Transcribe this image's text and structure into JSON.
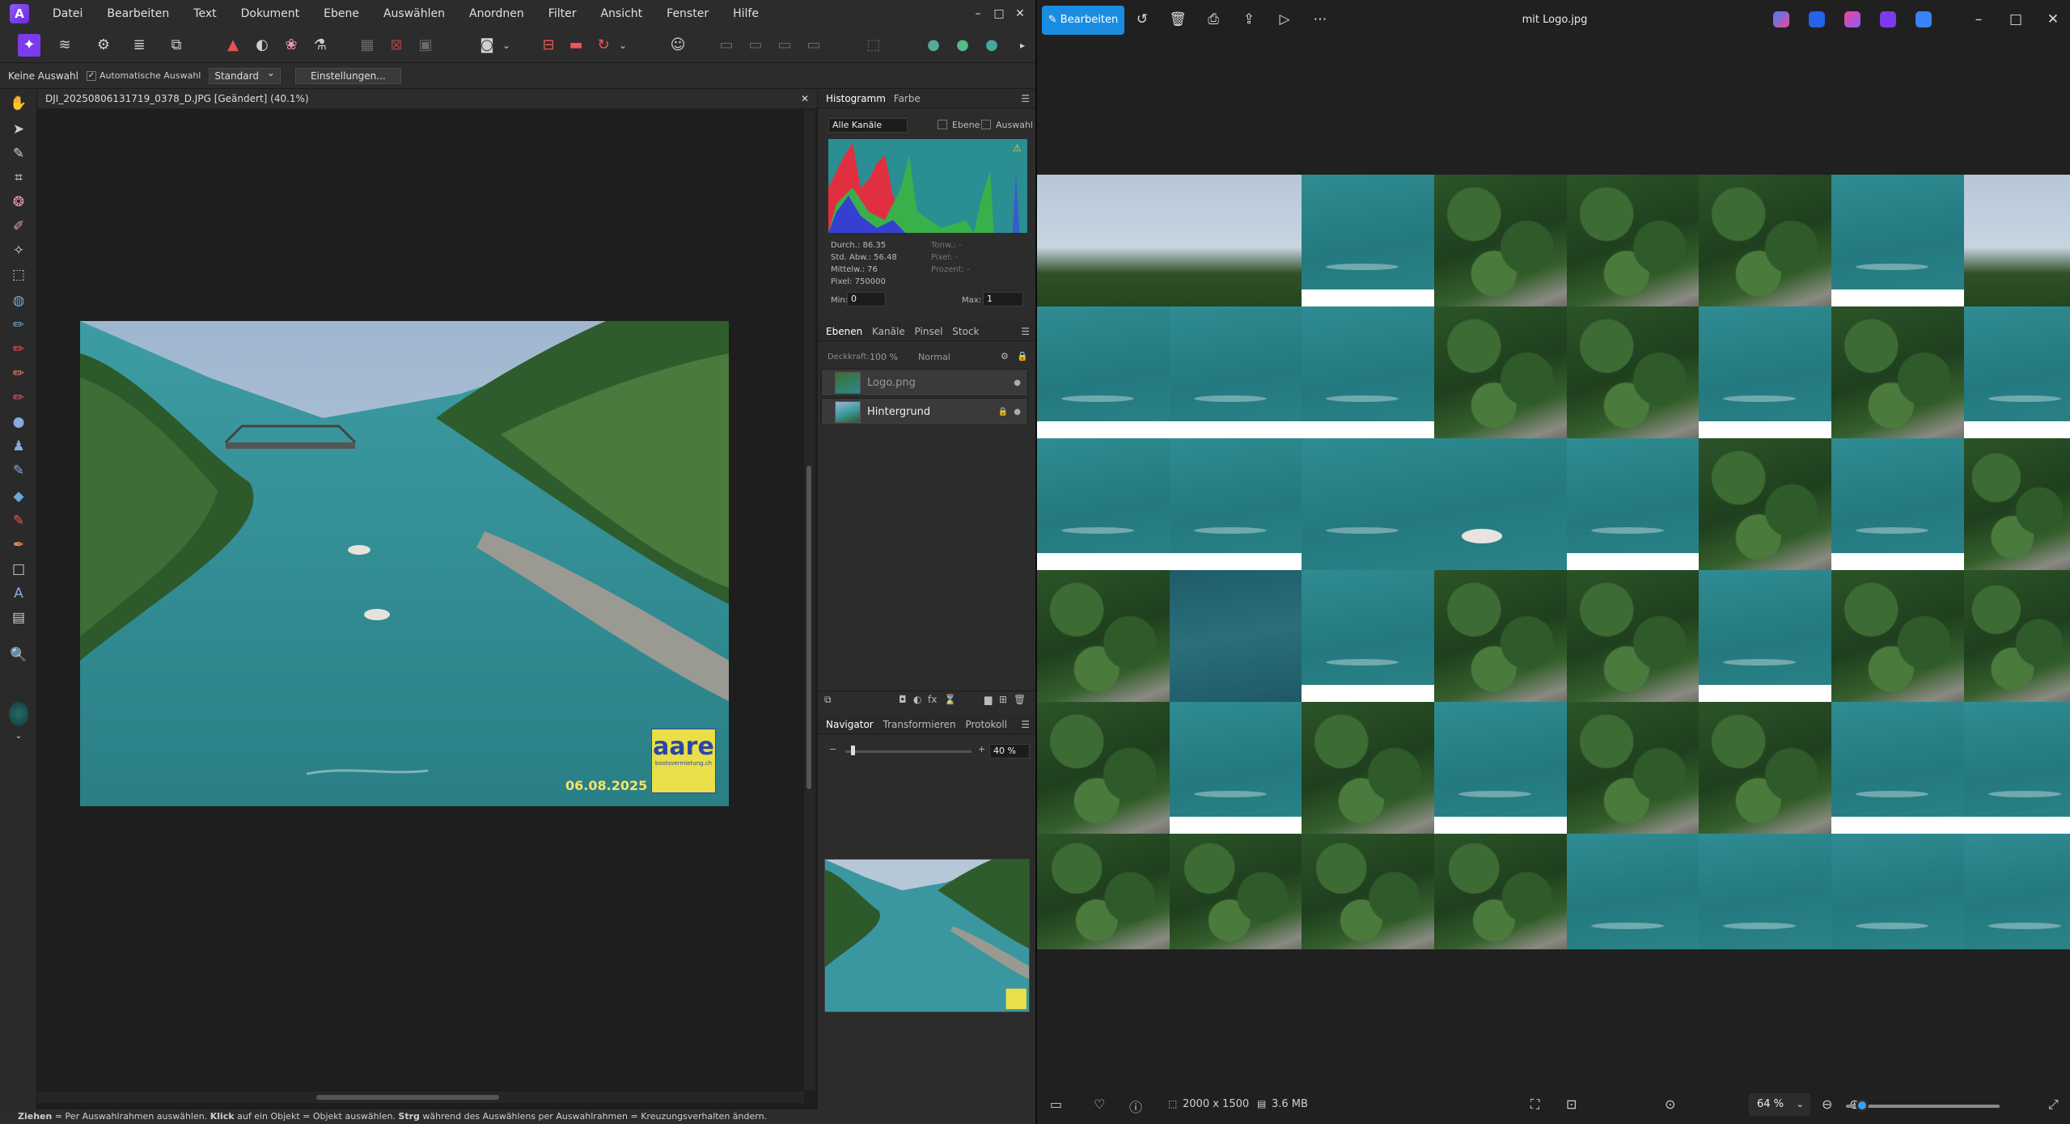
{
  "affinity": {
    "menu": [
      "Datei",
      "Bearbeiten",
      "Text",
      "Dokument",
      "Ebene",
      "Auswählen",
      "Anordnen",
      "Filter",
      "Ansicht",
      "Fenster",
      "Hilfe"
    ],
    "context": {
      "selection": "Keine Auswahl",
      "auto_select": "Automatische Auswahl",
      "mode": "Standard",
      "settings": "Einstellungen..."
    },
    "document_tab": "DJI_20250806131719_0378_D.JPG [Geändert] (40.1%)",
    "canvas": {
      "watermark_logo": "aare",
      "watermark_sub": "bootsvermietung.ch",
      "date": "06.08.2025"
    },
    "histogram": {
      "tabs": [
        "Histogramm",
        "Farbe"
      ],
      "channel": "Alle Kanäle",
      "opt_layer": "Ebene",
      "opt_sel": "Auswahl",
      "stats_left": [
        "Durch.: 86.35",
        "Std. Abw.: 56.48",
        "Mittelw.: 76",
        "Pixel: 750000"
      ],
      "stats_right": [
        "Tonw.: -",
        "Pixel: -",
        "Prozent: -"
      ],
      "min_label": "Min:",
      "min_value": "0",
      "max_label": "Max:",
      "max_value": "1"
    },
    "layers": {
      "tabs": [
        "Ebenen",
        "Kanäle",
        "Pinsel",
        "Stock"
      ],
      "opacity_label": "Deckkraft:",
      "opacity": "100 %",
      "blend": "Normal",
      "items": [
        {
          "name": "Logo.png"
        },
        {
          "name": "Hintergrund"
        }
      ]
    },
    "navigator": {
      "tabs": [
        "Navigator",
        "Transformieren",
        "Protokoll"
      ],
      "zoom": "40 %",
      "zoom_level": 0.4
    },
    "status_parts": [
      {
        "b": "Ziehen",
        "t": " = Per Auswahlrahmen auswählen. "
      },
      {
        "b": "Klick",
        "t": " auf ein Objekt = Objekt auswählen. "
      },
      {
        "b": "Strg",
        "t": " während des Auswählens per Auswahlrahmen = Kreuzungsverhalten ändern."
      }
    ]
  },
  "photos": {
    "edit_label": "Bearbeiten",
    "title": "mit Logo.jpg",
    "dimensions": "2000 x 1500",
    "filesize": "3.6 MB",
    "zoom": "64 %",
    "zoom_level": 0.64
  },
  "colors": {
    "accent": "#1a8de0",
    "affinity_brand": "#7c3aed"
  }
}
